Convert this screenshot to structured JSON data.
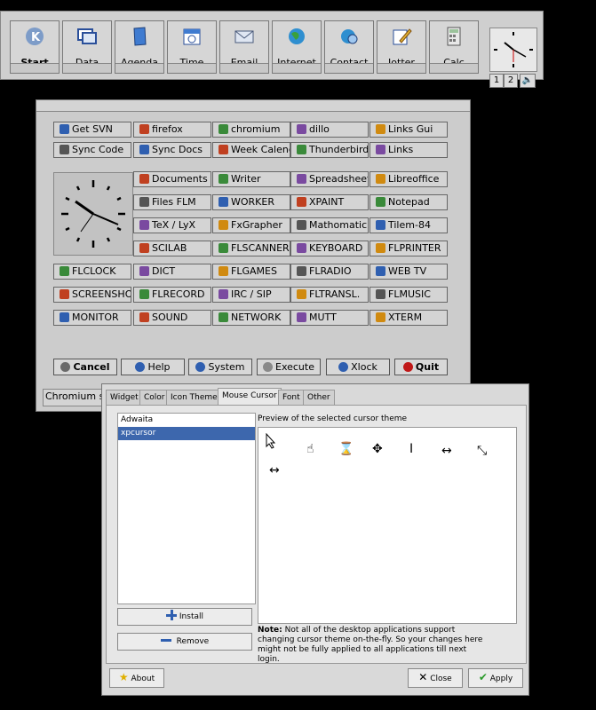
{
  "toolbar": {
    "buttons": [
      {
        "label": "Start",
        "icon": "kde-k-icon"
      },
      {
        "label": "Data",
        "icon": "window-icon"
      },
      {
        "label": "Agenda",
        "icon": "notebook-icon"
      },
      {
        "label": "Time",
        "icon": "calendar-clock-icon"
      },
      {
        "label": "Email",
        "icon": "mail-icon"
      },
      {
        "label": "Internet",
        "icon": "globe-icon"
      },
      {
        "label": "Contact",
        "icon": "contact-globe-icon"
      },
      {
        "label": "Jotter",
        "icon": "pencil-pad-icon"
      },
      {
        "label": "Calc",
        "icon": "calculator-icon"
      }
    ],
    "desktops": [
      "1",
      "2"
    ],
    "volume_icon": "speaker-icon"
  },
  "launcher": {
    "top_rows": [
      [
        "Get SVN",
        "firefox",
        "chromium",
        "dillo",
        "Links Gui"
      ],
      [
        "Sync Code",
        "Sync Docs",
        "Week Calend",
        "Thunderbird",
        "Links"
      ]
    ],
    "clock_rows": [
      [
        "Documents",
        "Writer",
        "Spreadsheet",
        "Libreoffice"
      ],
      [
        "Files FLM",
        "WORKER",
        "XPAINT",
        "Notepad"
      ],
      [
        "TeX / LyX",
        "FxGrapher",
        "Mathomatic",
        "Tilem-84"
      ],
      [
        "SCILAB",
        "FLSCANNER",
        "KEYBOARD",
        "FLPRINTER"
      ]
    ],
    "lower_rows": [
      [
        "FLCLOCK",
        "DICT",
        "FLGAMES",
        "FLRADIO",
        "WEB TV"
      ],
      [
        "SCREENSHOT",
        "FLRECORD",
        "IRC / SIP",
        "FLTRANSL.",
        "FLMUSIC"
      ],
      [
        "MONITOR",
        "SOUND",
        "NETWORK",
        "MUTT",
        "XTERM"
      ]
    ],
    "bottom_buttons": [
      {
        "label": "Cancel",
        "color": "#6a6a6a"
      },
      {
        "label": "Help",
        "color": "#2f5fb0"
      },
      {
        "label": "System",
        "color": "#2f5fb0"
      },
      {
        "label": "Execute",
        "color": "#8a8a8a"
      },
      {
        "label": "Xlock",
        "color": "#2f5fb0"
      },
      {
        "label": "Quit",
        "color": "#c01818"
      }
    ],
    "status_text": "Chromium s"
  },
  "dialog": {
    "tabs": [
      "Widget",
      "Color",
      "Icon Theme",
      "Mouse Cursor",
      "Font",
      "Other"
    ],
    "active_tab": "Mouse Cursor",
    "themes": [
      "Adwaita",
      "xpcursor"
    ],
    "selected_theme": "xpcursor",
    "install_label": "Install",
    "remove_label": "Remove",
    "preview_label": "Preview of the selected cursor theme",
    "cursors": [
      "arrow-cursor-icon",
      "hand-cursor-icon",
      "hourglass-cursor-icon",
      "move-cursor-icon",
      "ibeam-cursor-icon",
      "h-resize-cursor-icon",
      "diag-resize-cursor-icon",
      "h-resize-cursor-icon"
    ],
    "note_bold": "Note:",
    "note_text": "Not all of the desktop applications support changing cursor theme on-the-fly. So your changes here might not be fully applied to all applications till next login.",
    "about_label": "About",
    "close_label": "Close",
    "apply_label": "Apply"
  },
  "colors": {
    "accent_blue": "#3d67ad",
    "panel_gray": "#cccccc"
  }
}
